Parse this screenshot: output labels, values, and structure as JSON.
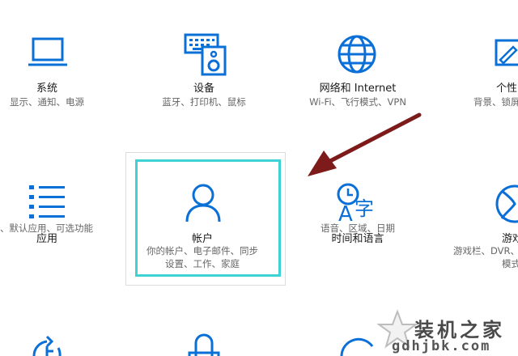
{
  "settings": {
    "tiles": [
      {
        "title": "系统",
        "desc": [
          "显示、通知、电源"
        ]
      },
      {
        "title": "设备",
        "desc": [
          "蓝牙、打印机、鼠标"
        ]
      },
      {
        "title": "网络和 Internet",
        "desc": [
          "Wi-Fi、飞行模式、VPN"
        ]
      },
      {
        "title": "个性",
        "desc": [
          "背景、锁屏"
        ]
      },
      {
        "title": "应用",
        "desc": [
          "、默认应用、可选功能"
        ]
      },
      {
        "title": "帐户",
        "desc": [
          "你的帐户、电子邮件、同步",
          "设置、工作、家庭"
        ]
      },
      {
        "title": "时间和语言",
        "desc": [
          "语音、区域、日期"
        ]
      },
      {
        "title": "游戏",
        "desc": [
          "游戏栏、DVR、",
          "模式"
        ]
      }
    ]
  },
  "icons": {
    "system": "laptop-icon",
    "devices": "keyboard-speaker-icon",
    "network": "globe-icon",
    "personalization": "paint-icon",
    "apps": "apps-list-icon",
    "accounts": "person-icon",
    "time_language": "clock-language-icon",
    "gaming": "xbox-icon"
  },
  "colors": {
    "accent": "#0a6fd6",
    "focus_border": "#3fd2d4",
    "arrow": "#7d1a1a"
  },
  "watermark": {
    "title": "装机之家",
    "url": "gdhjbk.com"
  }
}
